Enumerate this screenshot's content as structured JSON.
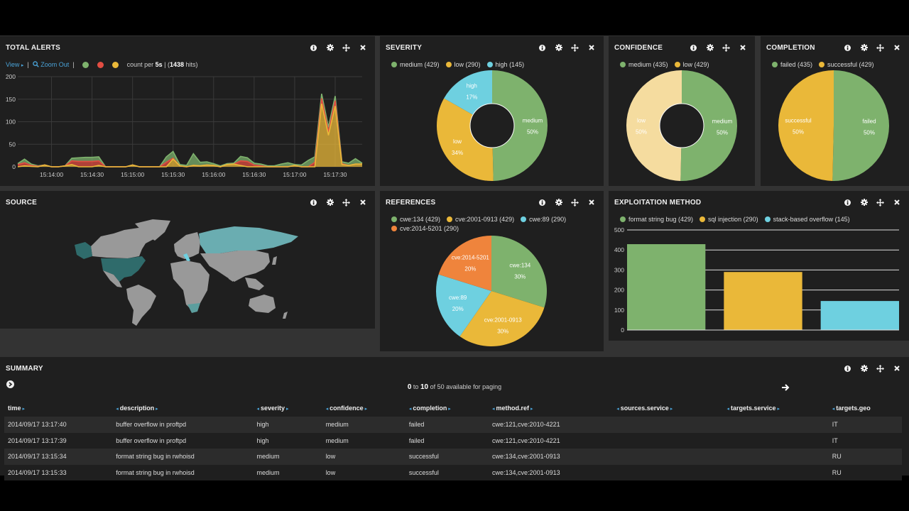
{
  "colors": {
    "green": "#7eb26d",
    "yellow": "#eab839",
    "red": "#e24d42",
    "cyan": "#6ed0e0",
    "orange": "#ef843c",
    "paleyellow": "#f5dc9f",
    "link": "#4aa3d8",
    "map_land": "#999999",
    "map_us": "#2f6b6b",
    "map_ru": "#6aadb1",
    "map_za": "#5c9e9e"
  },
  "panel_icons": [
    "info-icon",
    "gear-icon",
    "move-icon",
    "close-icon"
  ],
  "total_alerts": {
    "title": "TOTAL ALERTS",
    "view_label": "View",
    "zoom_out_label": "Zoom Out",
    "count_prefix": "count per ",
    "interval": "5s",
    "hits_prefix": " | (",
    "hits": "1438",
    "hits_suffix": " hits)"
  },
  "severity": {
    "title": "SEVERITY",
    "legend": [
      {
        "label": "medium (429)",
        "color": "#7eb26d"
      },
      {
        "label": "low (290)",
        "color": "#eab839"
      },
      {
        "label": "high (145)",
        "color": "#6ed0e0"
      }
    ]
  },
  "confidence": {
    "title": "CONFIDENCE",
    "legend": [
      {
        "label": "medium (435)",
        "color": "#7eb26d"
      },
      {
        "label": "low (429)",
        "color": "#eab839"
      }
    ]
  },
  "completion": {
    "title": "COMPLETION",
    "legend": [
      {
        "label": "failed (435)",
        "color": "#7eb26d"
      },
      {
        "label": "successful (429)",
        "color": "#eab839"
      }
    ]
  },
  "source": {
    "title": "SOURCE",
    "highlighted_countries": [
      "US",
      "RU",
      "IT",
      "ZA"
    ]
  },
  "references": {
    "title": "REFERENCES",
    "legend": [
      {
        "label": "cwe:134 (429)",
        "color": "#7eb26d"
      },
      {
        "label": "cve:2001-0913 (429)",
        "color": "#eab839"
      },
      {
        "label": "cwe:89 (290)",
        "color": "#6ed0e0"
      },
      {
        "label": "cve:2014-5201 (290)",
        "color": "#ef843c"
      }
    ]
  },
  "exploitation": {
    "title": "EXPLOITATION METHOD",
    "legend": [
      {
        "label": "format string bug (429)",
        "color": "#7eb26d"
      },
      {
        "label": "sql injection (290)",
        "color": "#eab839"
      },
      {
        "label": "stack-based overflow (145)",
        "color": "#6ed0e0"
      }
    ]
  },
  "summary": {
    "title": "SUMMARY",
    "pager": {
      "from": "0",
      "to_word": " to ",
      "to": "10",
      "rest": " of 50 available for paging"
    },
    "columns": [
      "time",
      "description",
      "severity",
      "confidence",
      "completion",
      "method.ref",
      "sources.service",
      "targets.service",
      "targets.geo"
    ],
    "rows": [
      [
        "2014/09/17 13:17:40",
        "buffer overflow in proftpd",
        "high",
        "medium",
        "failed",
        "cwe:121,cve:2010-4221",
        "",
        "",
        "IT"
      ],
      [
        "2014/09/17 13:17:39",
        "buffer overflow in proftpd",
        "high",
        "medium",
        "failed",
        "cwe:121,cve:2010-4221",
        "",
        "",
        "IT"
      ],
      [
        "2014/09/17 13:15:34",
        "format string bug in rwhoisd",
        "medium",
        "low",
        "successful",
        "cwe:134,cve:2001-0913",
        "",
        "",
        "RU"
      ],
      [
        "2014/09/17 13:15:33",
        "format string bug in rwhoisd",
        "medium",
        "low",
        "successful",
        "cwe:134,cve:2001-0913",
        "",
        "",
        "RU"
      ]
    ]
  },
  "chart_data": [
    {
      "id": "total_alerts",
      "type": "area",
      "title": "TOTAL ALERTS",
      "stacked": true,
      "ylim": [
        0,
        200
      ],
      "yticks": [
        0,
        50,
        100,
        150,
        200
      ],
      "xticks": [
        "15:14:00",
        "15:14:30",
        "15:15:00",
        "15:15:30",
        "15:16:00",
        "15:16:30",
        "15:17:00",
        "15:17:30"
      ],
      "x_start": "15:13:35",
      "x_step_seconds": 5,
      "grid": true,
      "series": [
        {
          "name": "yellow",
          "color": "#eab839",
          "values": [
            0,
            2,
            1,
            0,
            4,
            0,
            0,
            2,
            5,
            0,
            0,
            0,
            3,
            0,
            0,
            0,
            0,
            4,
            0,
            0,
            0,
            0,
            0,
            17,
            2,
            0,
            3,
            2,
            4,
            3,
            0,
            5,
            6,
            3,
            0,
            0,
            0,
            0,
            0,
            0,
            0,
            3,
            0,
            0,
            0,
            140,
            70,
            135,
            5,
            3,
            6,
            6
          ]
        },
        {
          "name": "red",
          "color": "#e24d42",
          "values": [
            5,
            7,
            2,
            1,
            0,
            0,
            0,
            0,
            8,
            12,
            12,
            12,
            10,
            0,
            0,
            0,
            0,
            0,
            0,
            0,
            0,
            0,
            10,
            2,
            0,
            0,
            0,
            0,
            0,
            0,
            0,
            0,
            0,
            10,
            12,
            4,
            2,
            0,
            0,
            0,
            0,
            0,
            0,
            0,
            10,
            12,
            8,
            12,
            2,
            0,
            0,
            0
          ]
        },
        {
          "name": "green",
          "color": "#7eb26d",
          "values": [
            2,
            8,
            3,
            1,
            0,
            0,
            0,
            0,
            6,
            8,
            9,
            9,
            9,
            0,
            0,
            0,
            0,
            0,
            0,
            0,
            0,
            0,
            12,
            15,
            3,
            3,
            26,
            8,
            7,
            4,
            2,
            2,
            2,
            10,
            8,
            4,
            4,
            2,
            2,
            6,
            9,
            2,
            4,
            14,
            12,
            10,
            10,
            10,
            4,
            5,
            12,
            2
          ]
        }
      ]
    },
    {
      "id": "severity",
      "type": "pie",
      "donut": true,
      "title": "SEVERITY",
      "slices": [
        {
          "label": "medium",
          "value": 429,
          "percent": "50%",
          "color": "#7eb26d"
        },
        {
          "label": "low",
          "value": 290,
          "percent": "34%",
          "color": "#eab839"
        },
        {
          "label": "high",
          "value": 145,
          "percent": "17%",
          "color": "#6ed0e0"
        }
      ]
    },
    {
      "id": "confidence",
      "type": "pie",
      "donut": true,
      "title": "CONFIDENCE",
      "slices": [
        {
          "label": "medium",
          "value": 435,
          "percent": "50%",
          "color": "#7eb26d"
        },
        {
          "label": "low",
          "value": 429,
          "percent": "50%",
          "color": "#f5dc9f"
        }
      ]
    },
    {
      "id": "completion",
      "type": "pie",
      "donut": false,
      "title": "COMPLETION",
      "slices": [
        {
          "label": "failed",
          "value": 435,
          "percent": "50%",
          "color": "#7eb26d"
        },
        {
          "label": "successful",
          "value": 429,
          "percent": "50%",
          "color": "#eab839"
        }
      ]
    },
    {
      "id": "references",
      "type": "pie",
      "donut": false,
      "title": "REFERENCES",
      "slices": [
        {
          "label": "cwe:134",
          "value": 429,
          "percent": "30%",
          "color": "#7eb26d"
        },
        {
          "label": "cve:2001-0913",
          "value": 429,
          "percent": "30%",
          "color": "#eab839"
        },
        {
          "label": "cwe:89",
          "value": 290,
          "percent": "20%",
          "color": "#6ed0e0"
        },
        {
          "label": "cve:2014-5201",
          "value": 290,
          "percent": "20%",
          "color": "#ef843c"
        }
      ]
    },
    {
      "id": "exploitation",
      "type": "bar",
      "title": "EXPLOITATION METHOD",
      "categories": [
        "format string bug",
        "sql injection",
        "stack-based overflow"
      ],
      "values": [
        429,
        290,
        145
      ],
      "colors": [
        "#7eb26d",
        "#eab839",
        "#6ed0e0"
      ],
      "ylim": [
        0,
        500
      ],
      "yticks": [
        0,
        100,
        200,
        300,
        400,
        500
      ]
    }
  ]
}
